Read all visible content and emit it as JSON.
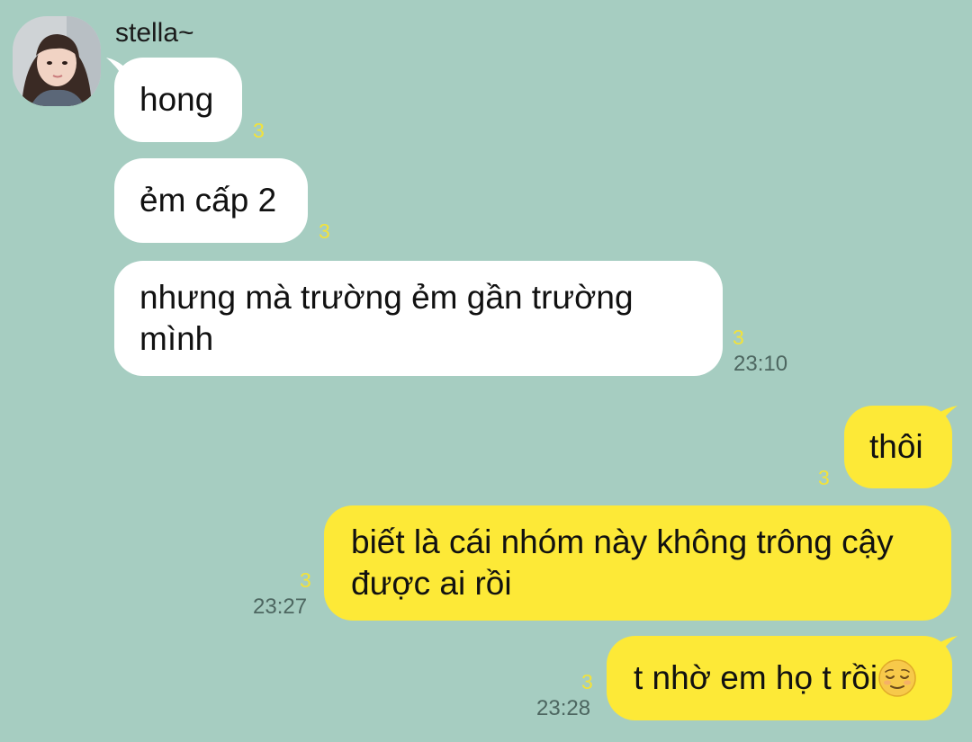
{
  "contact": {
    "name": "stella~"
  },
  "messages": [
    {
      "side": "in",
      "text": "hong",
      "read": "3"
    },
    {
      "side": "in",
      "text": "ẻm cấp 2",
      "read": "3"
    },
    {
      "side": "in",
      "line1": "nhưng mà trường ẻm gần trường",
      "line2": "mình",
      "read": "3",
      "time": "23:10"
    },
    {
      "side": "out",
      "text": "thôi",
      "read": "3"
    },
    {
      "side": "out",
      "line1": "biết là cái nhóm này không trông cậy",
      "line2": "được ai rồi",
      "read": "3",
      "time": "23:27"
    },
    {
      "side": "out",
      "text": "t nhờ em họ t rồi",
      "emoji": "relieved-face-icon",
      "read": "3",
      "time": "23:28"
    }
  ],
  "colors": {
    "background": "#a6cdc1",
    "incoming_bubble": "#ffffff",
    "outgoing_bubble": "#fde937",
    "read_count": "#f2e23a",
    "timestamp": "#4d6660"
  }
}
